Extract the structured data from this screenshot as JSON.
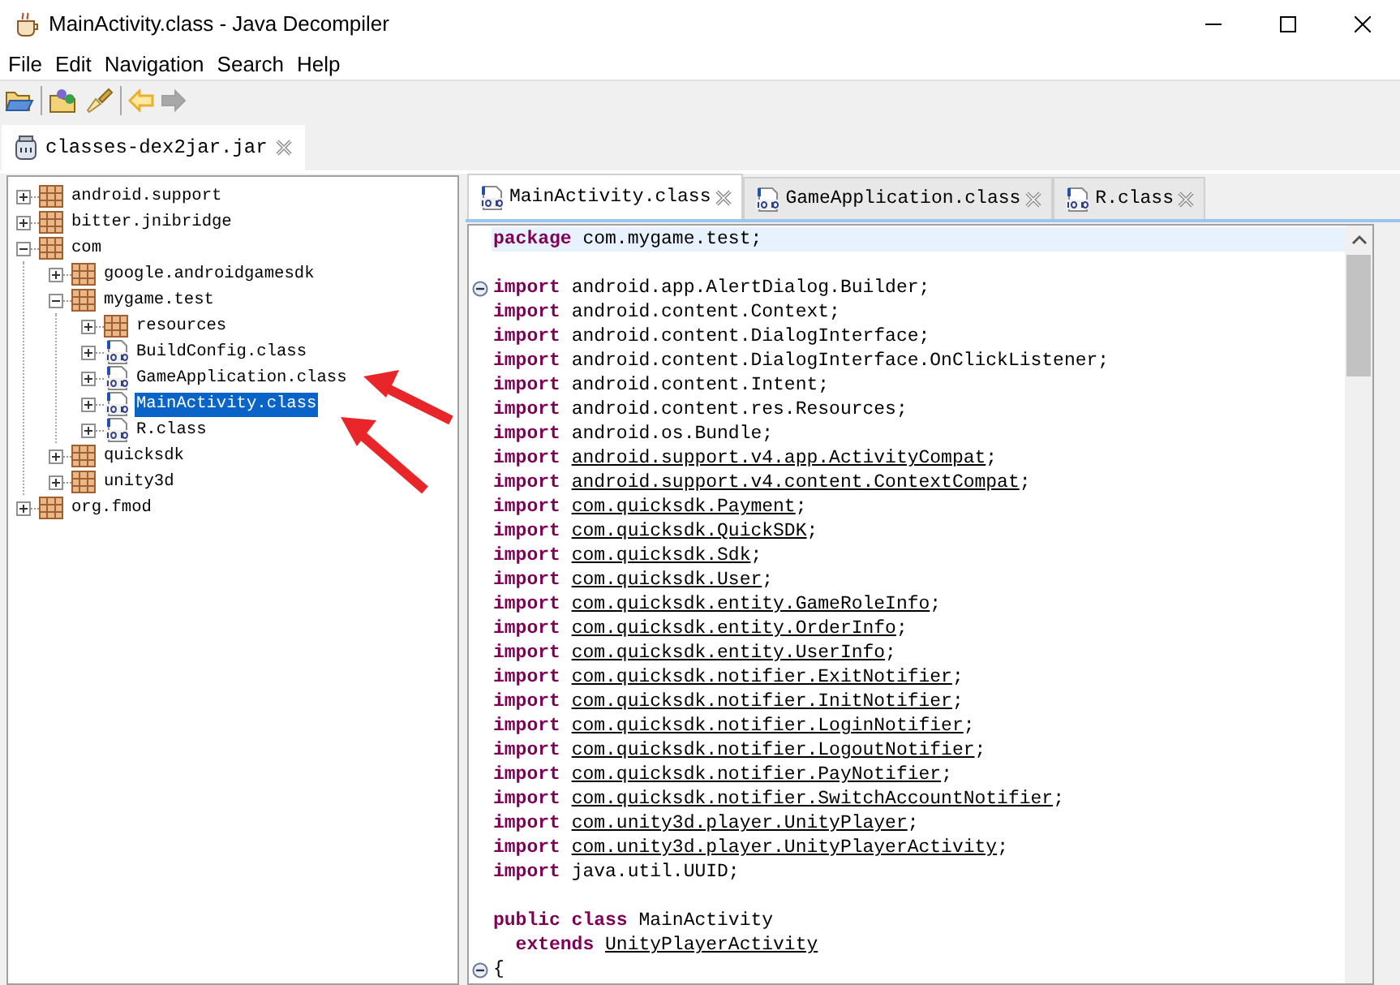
{
  "window": {
    "title": "MainActivity.class - Java Decompiler"
  },
  "menu": [
    "File",
    "Edit",
    "Navigation",
    "Search",
    "Help"
  ],
  "toolbar": [
    {
      "kind": "open",
      "disabled": false
    },
    {
      "kind": "open-type",
      "disabled": false
    },
    {
      "kind": "search",
      "disabled": false
    },
    {
      "kind": "back",
      "disabled": false
    },
    {
      "kind": "forward",
      "disabled": true
    }
  ],
  "file_tabs": [
    {
      "label": "classes-dex2jar.jar",
      "selected": true
    }
  ],
  "tree": [
    {
      "label": "android.support",
      "kind": "package",
      "expanded": false,
      "selected": false
    },
    {
      "label": "bitter.jnibridge",
      "kind": "package",
      "expanded": false,
      "selected": false
    },
    {
      "label": "com",
      "kind": "package",
      "expanded": true,
      "selected": false,
      "children": [
        {
          "label": "google.androidgamesdk",
          "kind": "package",
          "expanded": false,
          "selected": false
        },
        {
          "label": "mygame.test",
          "kind": "package",
          "expanded": true,
          "selected": false,
          "children": [
            {
              "label": "resources",
              "kind": "package",
              "expanded": false,
              "selected": false
            },
            {
              "label": "BuildConfig.class",
              "kind": "class",
              "expanded": false,
              "selected": false
            },
            {
              "label": "GameApplication.class",
              "kind": "class",
              "expanded": false,
              "selected": false
            },
            {
              "label": "MainActivity.class",
              "kind": "class",
              "expanded": false,
              "selected": true
            },
            {
              "label": "R.class",
              "kind": "class",
              "expanded": false,
              "selected": false
            }
          ]
        },
        {
          "label": "quicksdk",
          "kind": "package",
          "expanded": false,
          "selected": false
        },
        {
          "label": "unity3d",
          "kind": "package",
          "expanded": false,
          "selected": false
        }
      ]
    },
    {
      "label": "org.fmod",
      "kind": "package",
      "expanded": false,
      "selected": false
    }
  ],
  "editor_tabs": [
    {
      "label": "MainActivity.class",
      "selected": true
    },
    {
      "label": "GameApplication.class",
      "selected": false
    },
    {
      "label": "R.class",
      "selected": false
    }
  ],
  "code_lines": [
    {
      "kind": "code",
      "current": true,
      "tokens": [
        {
          "kind": "keyword",
          "text": "package "
        },
        {
          "kind": "plain",
          "text": "com.mygame.test;"
        }
      ]
    },
    {
      "kind": "blank",
      "current": false
    },
    {
      "kind": "fold-start",
      "current": false,
      "tokens": [
        {
          "kind": "keyword",
          "text": "import "
        },
        {
          "kind": "plain",
          "text": "android.app.AlertDialog.Builder;"
        }
      ]
    },
    {
      "kind": "code",
      "current": false,
      "tokens": [
        {
          "kind": "keyword",
          "text": "import "
        },
        {
          "kind": "plain",
          "text": "android.content.Context;"
        }
      ]
    },
    {
      "kind": "code",
      "current": false,
      "tokens": [
        {
          "kind": "keyword",
          "text": "import "
        },
        {
          "kind": "plain",
          "text": "android.content.DialogInterface;"
        }
      ]
    },
    {
      "kind": "code",
      "current": false,
      "tokens": [
        {
          "kind": "keyword",
          "text": "import "
        },
        {
          "kind": "plain",
          "text": "android.content.DialogInterface.OnClickListener;"
        }
      ]
    },
    {
      "kind": "code",
      "current": false,
      "tokens": [
        {
          "kind": "keyword",
          "text": "import "
        },
        {
          "kind": "plain",
          "text": "android.content.Intent;"
        }
      ]
    },
    {
      "kind": "code",
      "current": false,
      "tokens": [
        {
          "kind": "keyword",
          "text": "import "
        },
        {
          "kind": "plain",
          "text": "android.content.res.Resources;"
        }
      ]
    },
    {
      "kind": "code",
      "current": false,
      "tokens": [
        {
          "kind": "keyword",
          "text": "import "
        },
        {
          "kind": "plain",
          "text": "android.os.Bundle;"
        }
      ]
    },
    {
      "kind": "code",
      "current": false,
      "tokens": [
        {
          "kind": "keyword",
          "text": "import "
        },
        {
          "kind": "link",
          "text": "android.support.v4.app.ActivityCompat"
        },
        {
          "kind": "plain",
          "text": ";"
        }
      ]
    },
    {
      "kind": "code",
      "current": false,
      "tokens": [
        {
          "kind": "keyword",
          "text": "import "
        },
        {
          "kind": "link",
          "text": "android.support.v4.content.ContextCompat"
        },
        {
          "kind": "plain",
          "text": ";"
        }
      ]
    },
    {
      "kind": "code",
      "current": false,
      "tokens": [
        {
          "kind": "keyword",
          "text": "import "
        },
        {
          "kind": "link",
          "text": "com.quicksdk.Payment"
        },
        {
          "kind": "plain",
          "text": ";"
        }
      ]
    },
    {
      "kind": "code",
      "current": false,
      "tokens": [
        {
          "kind": "keyword",
          "text": "import "
        },
        {
          "kind": "link",
          "text": "com.quicksdk.QuickSDK"
        },
        {
          "kind": "plain",
          "text": ";"
        }
      ]
    },
    {
      "kind": "code",
      "current": false,
      "tokens": [
        {
          "kind": "keyword",
          "text": "import "
        },
        {
          "kind": "link",
          "text": "com.quicksdk.Sdk"
        },
        {
          "kind": "plain",
          "text": ";"
        }
      ]
    },
    {
      "kind": "code",
      "current": false,
      "tokens": [
        {
          "kind": "keyword",
          "text": "import "
        },
        {
          "kind": "link",
          "text": "com.quicksdk.User"
        },
        {
          "kind": "plain",
          "text": ";"
        }
      ]
    },
    {
      "kind": "code",
      "current": false,
      "tokens": [
        {
          "kind": "keyword",
          "text": "import "
        },
        {
          "kind": "link",
          "text": "com.quicksdk.entity.GameRoleInfo"
        },
        {
          "kind": "plain",
          "text": ";"
        }
      ]
    },
    {
      "kind": "code",
      "current": false,
      "tokens": [
        {
          "kind": "keyword",
          "text": "import "
        },
        {
          "kind": "link",
          "text": "com.quicksdk.entity.OrderInfo"
        },
        {
          "kind": "plain",
          "text": ";"
        }
      ]
    },
    {
      "kind": "code",
      "current": false,
      "tokens": [
        {
          "kind": "keyword",
          "text": "import "
        },
        {
          "kind": "link",
          "text": "com.quicksdk.entity.UserInfo"
        },
        {
          "kind": "plain",
          "text": ";"
        }
      ]
    },
    {
      "kind": "code",
      "current": false,
      "tokens": [
        {
          "kind": "keyword",
          "text": "import "
        },
        {
          "kind": "link",
          "text": "com.quicksdk.notifier.ExitNotifier"
        },
        {
          "kind": "plain",
          "text": ";"
        }
      ]
    },
    {
      "kind": "code",
      "current": false,
      "tokens": [
        {
          "kind": "keyword",
          "text": "import "
        },
        {
          "kind": "link",
          "text": "com.quicksdk.notifier.InitNotifier"
        },
        {
          "kind": "plain",
          "text": ";"
        }
      ]
    },
    {
      "kind": "code",
      "current": false,
      "tokens": [
        {
          "kind": "keyword",
          "text": "import "
        },
        {
          "kind": "link",
          "text": "com.quicksdk.notifier.LoginNotifier"
        },
        {
          "kind": "plain",
          "text": ";"
        }
      ]
    },
    {
      "kind": "code",
      "current": false,
      "tokens": [
        {
          "kind": "keyword",
          "text": "import "
        },
        {
          "kind": "link",
          "text": "com.quicksdk.notifier.LogoutNotifier"
        },
        {
          "kind": "plain",
          "text": ";"
        }
      ]
    },
    {
      "kind": "code",
      "current": false,
      "tokens": [
        {
          "kind": "keyword",
          "text": "import "
        },
        {
          "kind": "link",
          "text": "com.quicksdk.notifier.PayNotifier"
        },
        {
          "kind": "plain",
          "text": ";"
        }
      ]
    },
    {
      "kind": "code",
      "current": false,
      "tokens": [
        {
          "kind": "keyword",
          "text": "import "
        },
        {
          "kind": "link",
          "text": "com.quicksdk.notifier.SwitchAccountNotifier"
        },
        {
          "kind": "plain",
          "text": ";"
        }
      ]
    },
    {
      "kind": "code",
      "current": false,
      "tokens": [
        {
          "kind": "keyword",
          "text": "import "
        },
        {
          "kind": "link",
          "text": "com.unity3d.player.UnityPlayer"
        },
        {
          "kind": "plain",
          "text": ";"
        }
      ]
    },
    {
      "kind": "code",
      "current": false,
      "tokens": [
        {
          "kind": "keyword",
          "text": "import "
        },
        {
          "kind": "link",
          "text": "com.unity3d.player.UnityPlayerActivity"
        },
        {
          "kind": "plain",
          "text": ";"
        }
      ]
    },
    {
      "kind": "code",
      "current": false,
      "tokens": [
        {
          "kind": "keyword",
          "text": "import "
        },
        {
          "kind": "plain",
          "text": "java.util.UUID;"
        }
      ]
    },
    {
      "kind": "blank",
      "current": false
    },
    {
      "kind": "code",
      "current": false,
      "tokens": [
        {
          "kind": "keyword",
          "text": "public class "
        },
        {
          "kind": "plain",
          "text": "MainActivity"
        }
      ]
    },
    {
      "kind": "code",
      "current": false,
      "tokens": [
        {
          "kind": "keyword",
          "text": "  extends "
        },
        {
          "kind": "link",
          "text": "UnityPlayerActivity"
        }
      ]
    },
    {
      "kind": "fold-start",
      "current": false,
      "tokens": [
        {
          "kind": "plain",
          "text": "{"
        }
      ]
    }
  ]
}
